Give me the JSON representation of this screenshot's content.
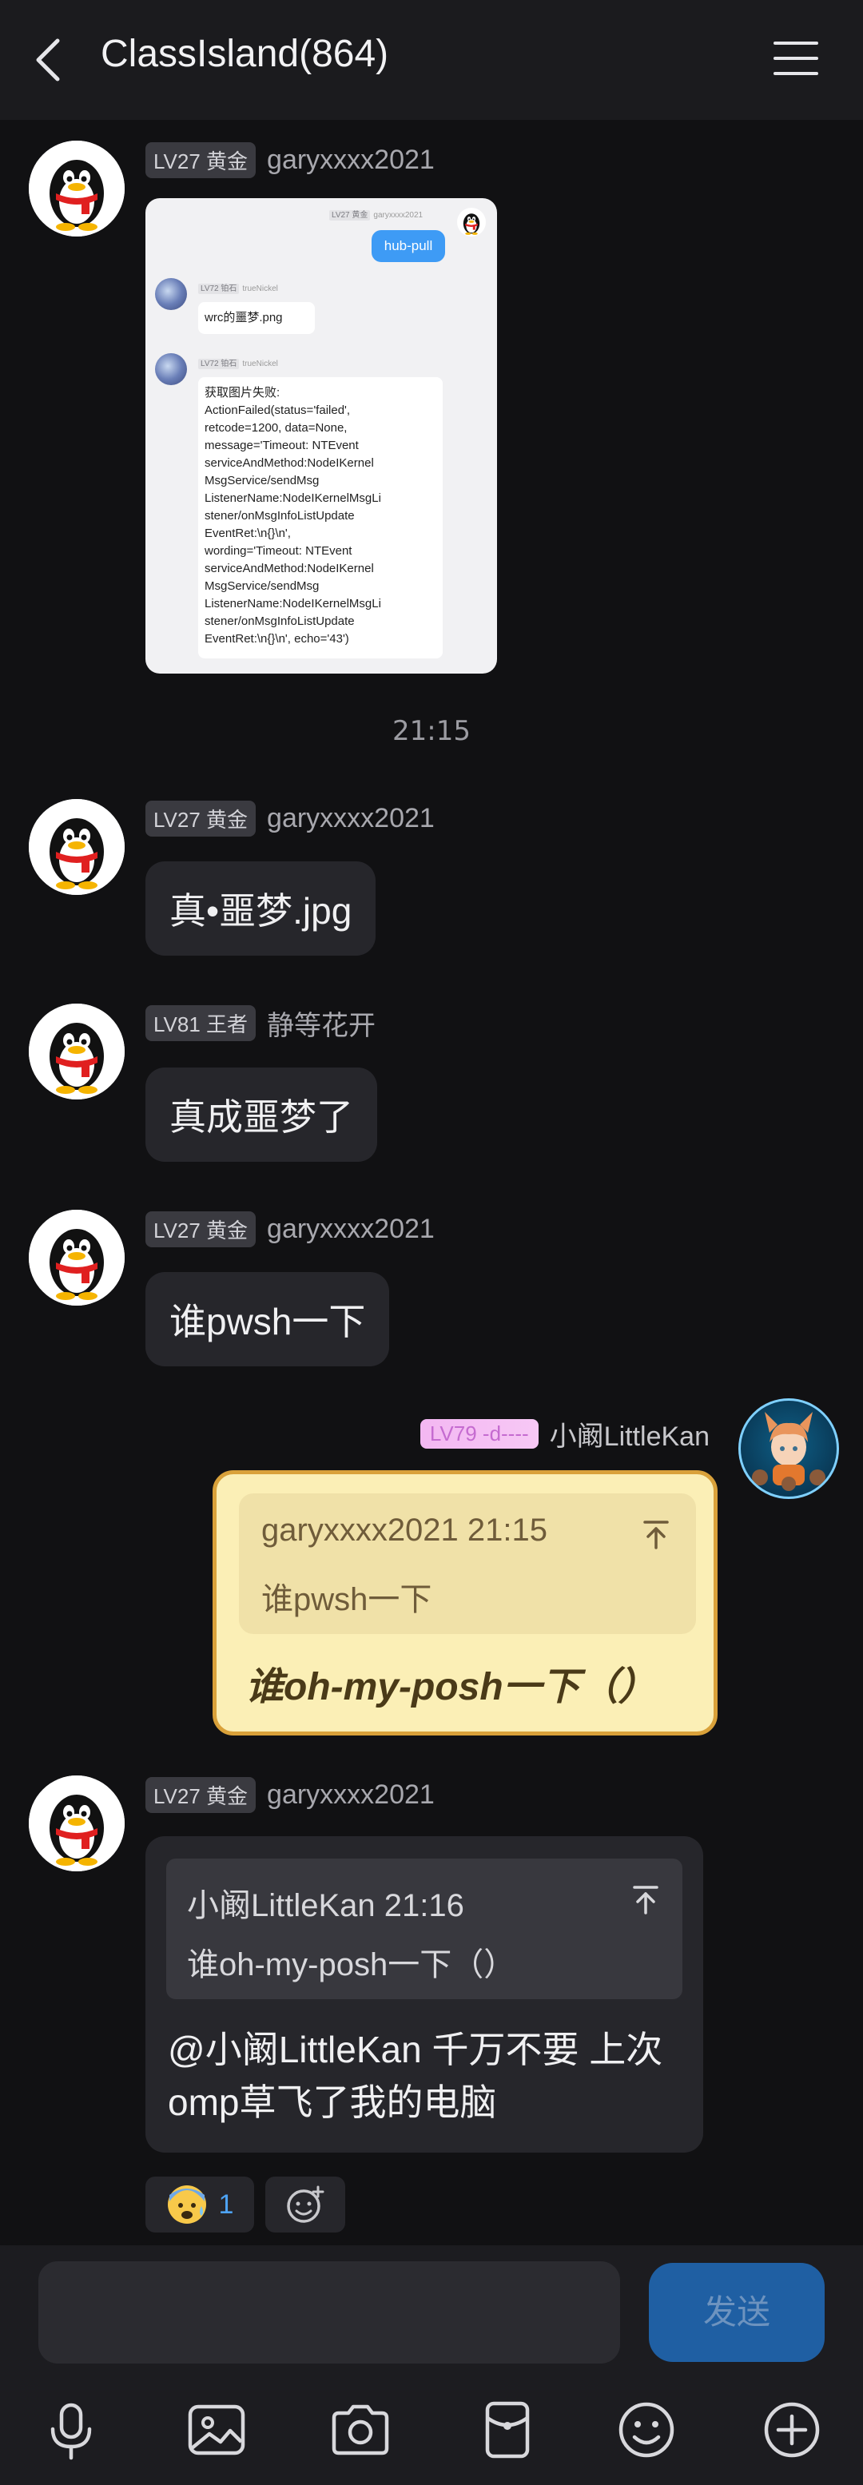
{
  "header": {
    "title": "ClassIsland(864)"
  },
  "messages": [
    {
      "level": "LV27 黄金",
      "nickname": "garyxxxx2021",
      "image": {
        "top_tag_level": "LV27 黄金",
        "top_tag_name": "garyxxxx2021",
        "sent_text": "hub-pull",
        "reply1_level": "LV72 铂石",
        "reply1_name": "trueNickel",
        "reply1_text": "wrc的噩梦.png",
        "reply2_level": "LV72 铂石",
        "reply2_name": "trueNickel",
        "reply2_lines": [
          "获取图片失败:",
          "ActionFailed(status='failed',",
          "retcode=1200, data=None,",
          "message='Timeout: NTEvent",
          "serviceAndMethod:NodeIKernel",
          "MsgService/sendMsg",
          "ListenerName:NodeIKernelMsgLi",
          "stener/onMsgInfoListUpdate",
          "EventRet:\\n{}\\n',",
          "wording='Timeout: NTEvent",
          "serviceAndMethod:NodeIKernel",
          "MsgService/sendMsg",
          "ListenerName:NodeIKernelMsgLi",
          "stener/onMsgInfoListUpdate",
          "EventRet:\\n{}\\n', echo='43')"
        ]
      }
    },
    {
      "level": "LV27 黄金",
      "nickname": "garyxxxx2021",
      "text": "真•噩梦.jpg"
    },
    {
      "level": "LV81 王者",
      "nickname": "静等花开",
      "text": "真成噩梦了"
    },
    {
      "level": "LV27 黄金",
      "nickname": "garyxxxx2021",
      "text": "谁pwsh一下"
    }
  ],
  "time_divider": "21:15",
  "outgoing": {
    "level": "LV79 -d----",
    "nickname": "小阚LittleKan",
    "reply_name": "garyxxxx2021 21:15",
    "reply_text": "谁pwsh一下",
    "text": "谁oh-my-posh一下（）"
  },
  "last_message": {
    "level": "LV27 黄金",
    "nickname": "garyxxxx2021",
    "reply_name": "小阚LittleKan 21:16",
    "reply_text": "谁oh-my-posh一下（）",
    "text": "@小阚LittleKan 千万不要 上次omp草飞了我的电脑",
    "reaction_count": "1"
  },
  "input": {
    "placeholder": "",
    "send_label": "发送"
  },
  "colors": {
    "background": "#111113",
    "bubble": "#26262b",
    "accent_blue": "#1f5fa3",
    "scroll_bubble": "#fbefb6"
  },
  "toolbar": {
    "icons": [
      "microphone-icon",
      "image-icon",
      "camera-icon",
      "red-packet-icon",
      "emoji-icon",
      "plus-icon"
    ]
  }
}
